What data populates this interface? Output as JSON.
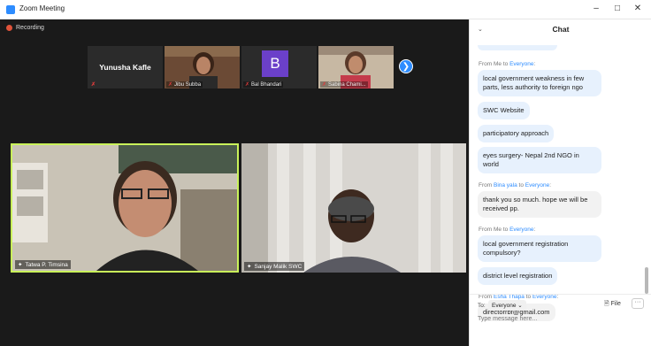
{
  "window": {
    "title": "Zoom Meeting",
    "controls": [
      "–",
      "□",
      "✕"
    ]
  },
  "recording": {
    "label": "Recording"
  },
  "strip": {
    "tiles": [
      {
        "name": "Yunusha Kafle",
        "type": "name-only"
      },
      {
        "name": "Jibu Subba",
        "type": "video"
      },
      {
        "name": "Bal Bhandari",
        "type": "avatar",
        "avatar_letter": "B"
      },
      {
        "name": "Sabina Chami...",
        "type": "video"
      }
    ],
    "next_icon": "❯"
  },
  "main_videos": [
    {
      "name": "Tatwa P. Timsina",
      "active_speaker": true
    },
    {
      "name": "Sanjay Malik SWC",
      "active_speaker": false
    }
  ],
  "chat": {
    "title": "Chat",
    "collapse_icon": "⌄",
    "groups": [
      {
        "from": "Me",
        "to": "Everyone",
        "messages": [
          "local government weakness in few parts, less authority to foreign ngo",
          "SWC Website",
          "participatory approach",
          "eyes surgery- Nepal 2nd NGO in world"
        ]
      },
      {
        "from": "Bina yala",
        "to": "Everyone",
        "messages": [
          "thank you so much. hope we will be received pp."
        ]
      },
      {
        "from": "Me",
        "to": "Everyone",
        "messages": [
          "local government registration compulsory?",
          "district level registration"
        ]
      },
      {
        "from": "Esha Thapa",
        "to": "Everyone",
        "messages": [
          "directorrbf@gmail.com"
        ]
      }
    ],
    "from_word": "From",
    "to_word": "to",
    "footer": {
      "to_label": "To:",
      "recipient": "Everyone ⌄",
      "file_label": "File",
      "more_label": "···",
      "placeholder": "Type message here..."
    }
  },
  "colors": {
    "accent": "#2d8cff",
    "bubble": "#e7f1fd",
    "active_speaker_border": "#c9f25a"
  }
}
